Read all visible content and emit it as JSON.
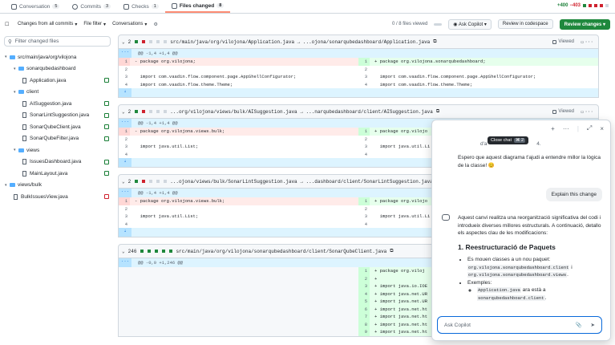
{
  "tabs": [
    {
      "label": "Conversation",
      "count": "5"
    },
    {
      "label": "Commits",
      "count": "3"
    },
    {
      "label": "Checks",
      "count": "1"
    },
    {
      "label": "Files changed",
      "count": "8"
    }
  ],
  "diffstat": {
    "add": "+400",
    "del": "−403"
  },
  "toolbar": {
    "changes": "Changes from all commits",
    "file_filter": "File filter",
    "conversations": "Conversations",
    "viewed": "0 / 8 files viewed",
    "ask_copilot": "Ask Copilot",
    "review_codespace": "Review in codespace",
    "review_changes": "Review changes"
  },
  "sidebar": {
    "filter_placeholder": "Filter changed files",
    "tree": [
      {
        "label": "src/main/java/org/vilojona",
        "type": "folder",
        "indent": 0
      },
      {
        "label": "sonarqubedashboard",
        "type": "folder",
        "indent": 1
      },
      {
        "label": "Application.java",
        "type": "file",
        "indent": 2,
        "stat": "+"
      },
      {
        "label": "client",
        "type": "folder",
        "indent": 1
      },
      {
        "label": "AISuggestion.java",
        "type": "file",
        "indent": 2,
        "stat": "+"
      },
      {
        "label": "SonarLintSuggestion.java",
        "type": "file",
        "indent": 2,
        "stat": "+"
      },
      {
        "label": "SonarQubeClient.java",
        "type": "file",
        "indent": 2,
        "stat": "+"
      },
      {
        "label": "SonarQubeFilter.java",
        "type": "file",
        "indent": 2,
        "stat": "+"
      },
      {
        "label": "views",
        "type": "folder",
        "indent": 1
      },
      {
        "label": "IssuesDashboard.java",
        "type": "file",
        "indent": 2,
        "stat": "+"
      },
      {
        "label": "MainLayout.java",
        "type": "file",
        "indent": 2,
        "stat": "+"
      },
      {
        "label": "views/bulk",
        "type": "folder",
        "indent": 0
      },
      {
        "label": "BulkIssuesView.java",
        "type": "file",
        "indent": 1,
        "stat": "-"
      }
    ]
  },
  "files": [
    {
      "count": "2",
      "path": "src/main/java/org/vilojona/Application.java → ...ojona/sonarqubedashboard/Application.java",
      "hunk": "@@ -1,4 +1,4 @@",
      "rows": [
        {
          "t": "mod",
          "ln": "1",
          "code": "- package org.vilojona;",
          "rn": "1",
          "rcode": "+ package org.vilojona.sonarqubedashboard;"
        },
        {
          "t": "ctx",
          "ln": "2",
          "code": "",
          "rn": "2",
          "rcode": ""
        },
        {
          "t": "ctx",
          "ln": "3",
          "code": "  import com.vaadin.flow.component.page.AppShellConfigurator;",
          "rn": "3",
          "rcode": "  import com.vaadin.flow.component.page.AppShellConfigurator;"
        },
        {
          "t": "ctx",
          "ln": "4",
          "code": "  import com.vaadin.flow.theme.Theme;",
          "rn": "4",
          "rcode": "  import com.vaadin.flow.theme.Theme;"
        }
      ]
    },
    {
      "count": "2",
      "path": "...org/vilojona/views/bulk/AISuggestion.java → ...narqubedashboard/client/AISuggestion.java",
      "hunk": "@@ -1,4 +1,4 @@",
      "rows": [
        {
          "t": "mod",
          "ln": "1",
          "code": "- package org.vilojona.views.bulk;",
          "rn": "1",
          "rcode": "+ package org.vilojo"
        },
        {
          "t": "ctx",
          "ln": "2",
          "code": "",
          "rn": "2",
          "rcode": ""
        },
        {
          "t": "ctx",
          "ln": "3",
          "code": "  import java.util.List;",
          "rn": "3",
          "rcode": "  import java.util.Li"
        },
        {
          "t": "ctx",
          "ln": "4",
          "code": "",
          "rn": "4",
          "rcode": ""
        }
      ]
    },
    {
      "count": "2",
      "path": "...ojona/views/bulk/SonarLintSuggestion.java → ...dashboard/client/SonarLintSuggestion.java",
      "hunk": "@@ -1,4 +1,4 @@",
      "rows": [
        {
          "t": "mod",
          "ln": "1",
          "code": "- package org.vilojona.views.bulk;",
          "rn": "1",
          "rcode": "+ package org.vilojo"
        },
        {
          "t": "ctx",
          "ln": "2",
          "code": "",
          "rn": "2",
          "rcode": ""
        },
        {
          "t": "ctx",
          "ln": "3",
          "code": "  import java.util.List;",
          "rn": "3",
          "rcode": "  import java.util.Li"
        },
        {
          "t": "ctx",
          "ln": "4",
          "code": "",
          "rn": "4",
          "rcode": ""
        }
      ]
    },
    {
      "count": "246",
      "path": "src/main/java/org/vilojona/sonarqubedashboard/client/SonarQubeClient.java",
      "hunk": "@@ -0,0 +1,246 @@",
      "rows": [
        {
          "t": "add",
          "rn": "1",
          "rcode": "+ package org.viloj"
        },
        {
          "t": "add",
          "rn": "2",
          "rcode": "+"
        },
        {
          "t": "add",
          "rn": "3",
          "rcode": "+ import java.io.IOE"
        },
        {
          "t": "add",
          "rn": "4",
          "rcode": "+ import java.net.UR"
        },
        {
          "t": "add",
          "rn": "5",
          "rcode": "+ import java.net.UR"
        },
        {
          "t": "add",
          "rn": "6",
          "rcode": "+ import java.net.ht"
        },
        {
          "t": "add",
          "rn": "7",
          "rcode": "+ import java.net.ht"
        },
        {
          "t": "add",
          "rn": "8",
          "rcode": "+ import java.net.ht"
        },
        {
          "t": "add",
          "rn": "9",
          "rcode": "+ import java.net.ht"
        }
      ]
    }
  ],
  "chat": {
    "tooltip": "Close chat",
    "tooltip_key": "⌘ 2",
    "partial": "d'a",
    "partial2": "4.",
    "msg1": "Espero que aquest diagrama t'ajudi a entendre millor la lògica de la classe! 😊",
    "user_msg": "Explain this change",
    "msg2": "Aquest canvi realitza una reorganització significativa del codi i introdueix diverses millores estructurals. A continuació, detallo els aspectes clau de les modificacions:",
    "heading": "1. Reestructuració de Paquets",
    "b1": "Es mouen classes a un nou paquet:",
    "c1": "org.vilojona.sonarqubedashboard.client",
    "c1b": " i",
    "c2": "org.vilojona.sonarqubedashboard.views",
    "c2b": ".",
    "b2": "Exemples:",
    "c3": "Application.java",
    "b3": " ara està a",
    "c4": "sonarqubedashboard.client",
    "c4b": ".",
    "placeholder": "Ask Copilot"
  }
}
